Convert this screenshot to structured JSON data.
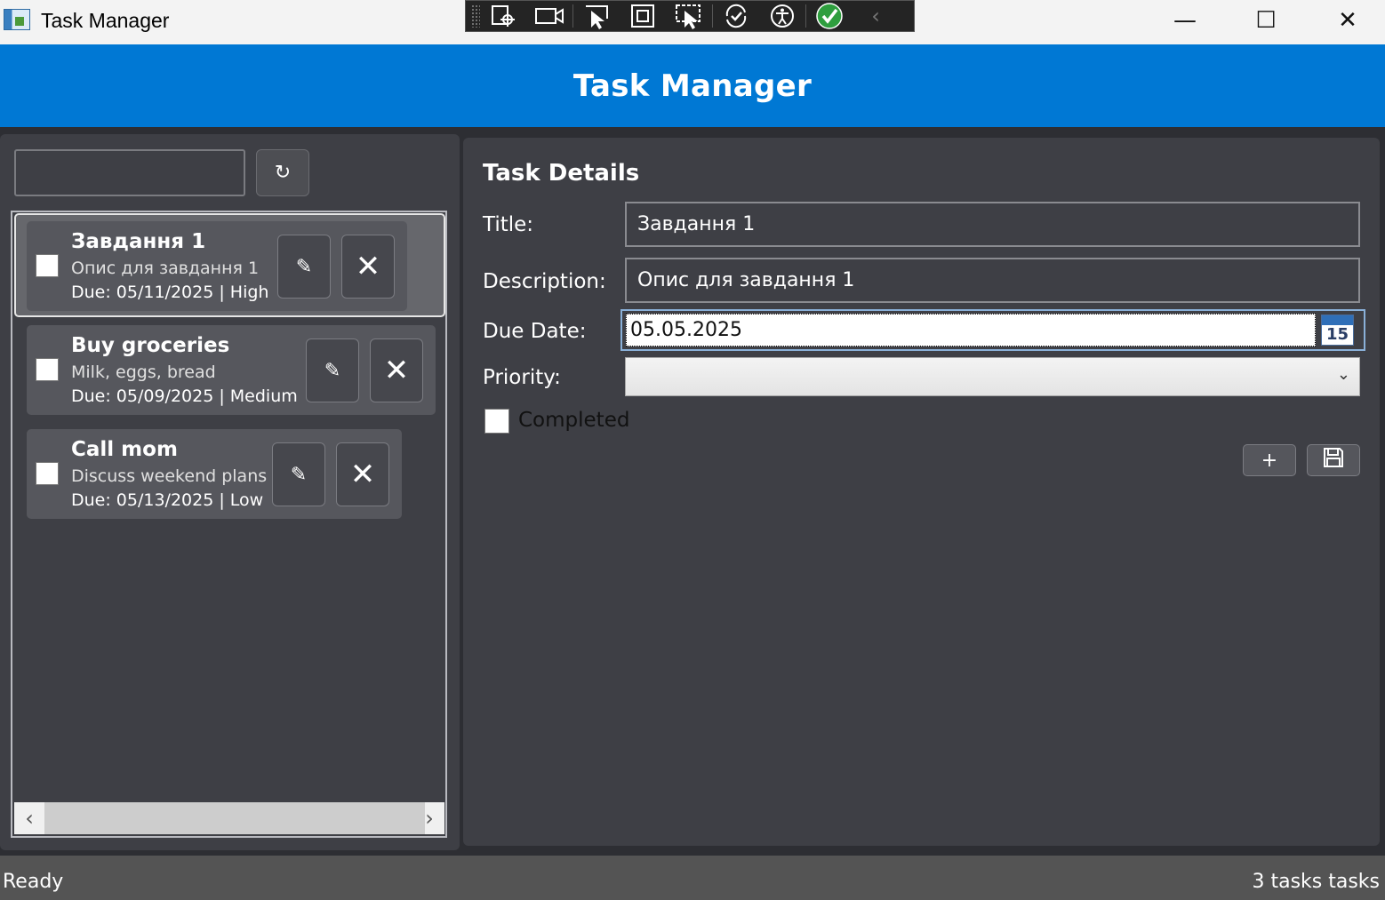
{
  "window": {
    "title": "Task Manager",
    "minimize_glyph": "—",
    "maximize_glyph": "☐",
    "close_glyph": "✕"
  },
  "header": {
    "title": "Task Manager"
  },
  "sidebar": {
    "search": {
      "value": "",
      "placeholder": ""
    },
    "refresh_glyph": "↻",
    "tasks": [
      {
        "title": "Завдання 1",
        "description": "Опис для завдання 1",
        "meta": "Due: 05/11/2025  |  High",
        "completed": false,
        "selected": true
      },
      {
        "title": "Buy groceries",
        "description": "Milk, eggs, bread",
        "meta": "Due: 05/09/2025  |  Medium",
        "completed": false,
        "selected": false
      },
      {
        "title": "Call mom",
        "description": "Discuss weekend plans",
        "meta": "Due: 05/13/2025  |  Low",
        "completed": false,
        "selected": false
      }
    ],
    "edit_glyph": "✎",
    "delete_glyph": "✕",
    "scroll_left": "‹",
    "scroll_right": "›"
  },
  "details": {
    "heading": "Task Details",
    "title_label": "Title:",
    "title_value": "Завдання 1",
    "description_label": "Description:",
    "description_value": "Опис для завдання 1",
    "due_label": "Due Date:",
    "due_value": "05.05.2025",
    "calendar_day": "15",
    "priority_label": "Priority:",
    "priority_value": "",
    "completed_label": "Completed",
    "add_glyph": "+",
    "save_icon": "save-icon"
  },
  "status": {
    "left": "Ready",
    "right": "3 tasks tasks"
  },
  "colors": {
    "accent": "#0078d4",
    "panel": "#3e3f45",
    "background": "#2d2e33",
    "statusbar": "#545454"
  }
}
